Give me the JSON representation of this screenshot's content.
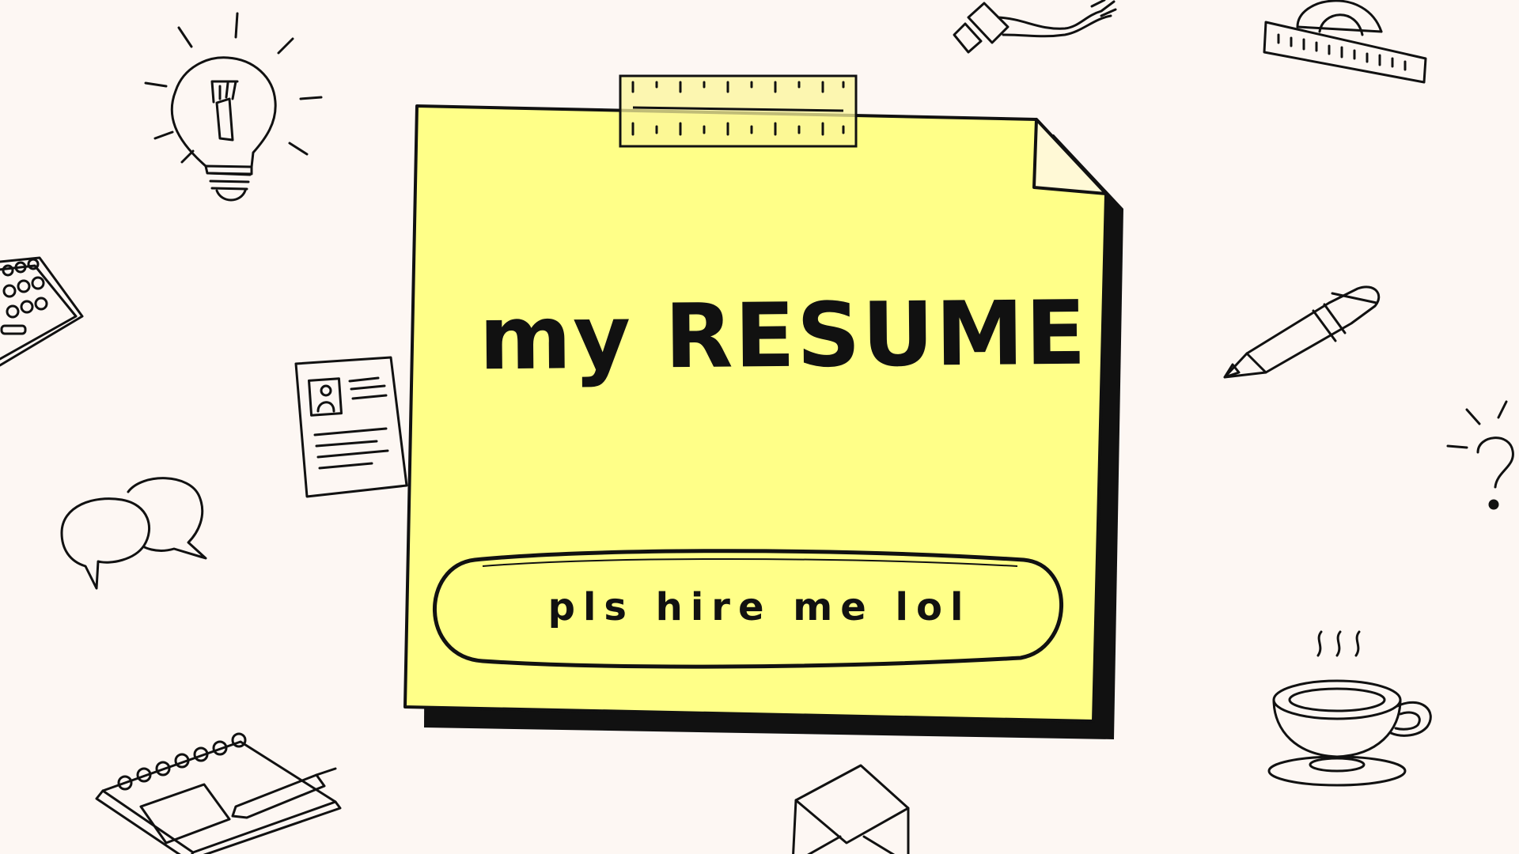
{
  "slide": {
    "title": "my RESUME",
    "tagline": "pls hire me lol"
  },
  "colors": {
    "background": "#fdf7f3",
    "note": "#ffff88",
    "tape": "#fbf59a",
    "ink": "#111111"
  },
  "icons": [
    "lightbulb-icon",
    "keyboard-icon",
    "resume-card-icon",
    "speech-bubbles-icon",
    "notebook-pencil-icon",
    "glue-tube-icon",
    "protractor-ruler-icon",
    "pen-icon",
    "question-mark-icon",
    "coffee-cup-icon",
    "envelope-icon"
  ]
}
